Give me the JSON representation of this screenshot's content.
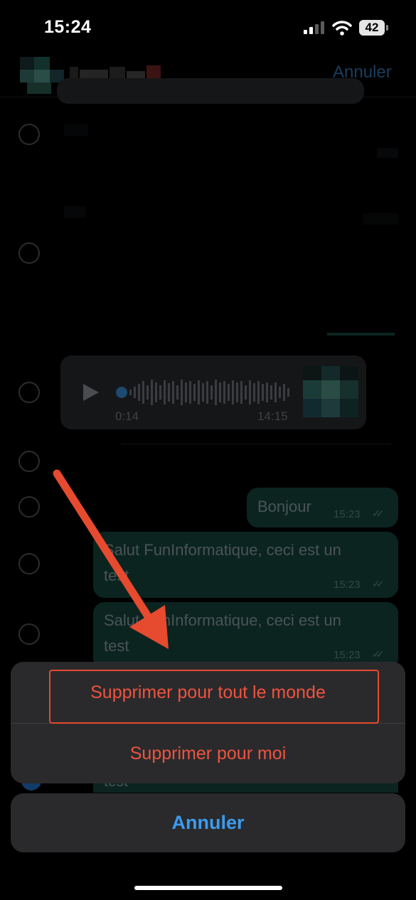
{
  "status_bar": {
    "time": "15:24",
    "battery": "42"
  },
  "header": {
    "cancel": "Annuler"
  },
  "voice_message": {
    "elapsed": "0:14",
    "time": "14:15"
  },
  "messages": [
    {
      "text": "Bonjour",
      "time": "15:23"
    },
    {
      "text_line1": "Salut FunInformatique, ceci est un",
      "text_line2": "test",
      "time": "15:23"
    },
    {
      "text_line1": "Salut FunInformatique, ceci est un",
      "text_line2": "test",
      "time": "15:23"
    },
    {
      "text_line2": "test"
    }
  ],
  "action_sheet": {
    "delete_for_everyone": "Supprimer pour tout le monde",
    "delete_for_me": "Supprimer pour moi",
    "cancel": "Annuler"
  },
  "colors": {
    "destructive": "#f0533f",
    "cancel_blue": "#3b9bf0",
    "annotation": "#e64a2f"
  }
}
